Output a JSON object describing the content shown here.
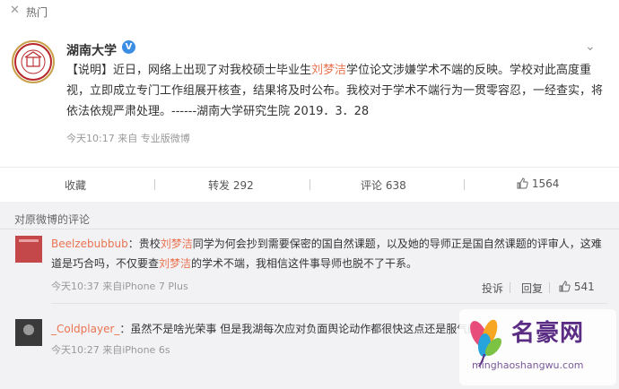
{
  "topbar": {
    "close": "✕",
    "tab": "热门"
  },
  "post": {
    "account_name": "湖南大学",
    "verified_mark": "V",
    "text_part1": "【说明】近日，网络上出现了对我校硕士毕业生",
    "highlight_name": "刘梦洁",
    "text_part2": "学位论文涉嫌学术不端的反映。学校对此高度重视，立即成立专门工作组展开核查，结果将及时公布。我校对于学术不端行为一贯零容忍，一经查实，将依法依规严肃处理。------湖南大学研究生院 2019．3．28",
    "meta": "今天10:17 来自 专业版微博",
    "actions": {
      "favorite": "收藏",
      "repost": "转发 292",
      "comment": "评论 638",
      "like": "1564"
    }
  },
  "comments_title": "对原微博的评论",
  "comments": [
    {
      "username": "Beelzebubbub",
      "text_a": "：贵校",
      "hl1": "刘梦洁",
      "text_b": "同学为何会抄到需要保密的国自然课题，以及她的导师正是国自然课题的评审人，这难道是巧合吗，不仅要查",
      "hl2": "刘梦洁",
      "text_c": "的学术不端，我相信这件事导师也脱不了干系。",
      "meta": "今天10:37 来自iPhone 7 Plus",
      "report": "投诉",
      "reply": "回复",
      "likes": "541"
    },
    {
      "username": "_Coldplayer_",
      "text": "：虽然不是啥光荣事 但是我湖每次应对负面舆论动作都很快这点还是服气的",
      "meta": "今天10:27 来自iPhone 6s"
    }
  ],
  "watermark": {
    "title": "名豪网",
    "url": "minghaoshangwu.com"
  },
  "colors": {
    "accent": "#eb7350",
    "verified": "#3b8ee4",
    "watermark": "#5a2c83"
  }
}
